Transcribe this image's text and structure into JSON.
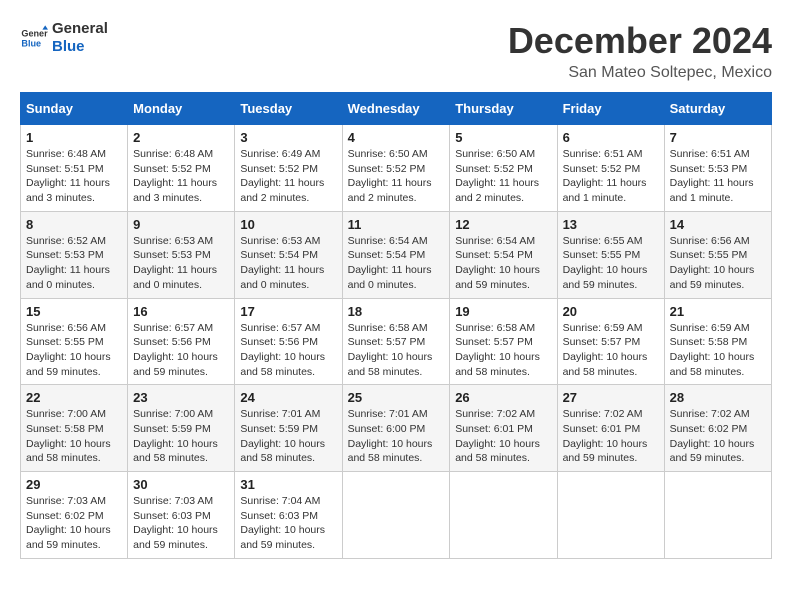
{
  "header": {
    "logo_line1": "General",
    "logo_line2": "Blue",
    "title": "December 2024",
    "subtitle": "San Mateo Soltepec, Mexico"
  },
  "weekdays": [
    "Sunday",
    "Monday",
    "Tuesday",
    "Wednesday",
    "Thursday",
    "Friday",
    "Saturday"
  ],
  "weeks": [
    [
      {
        "day": "1",
        "sunrise": "6:48 AM",
        "sunset": "5:51 PM",
        "daylight": "11 hours and 3 minutes."
      },
      {
        "day": "2",
        "sunrise": "6:48 AM",
        "sunset": "5:52 PM",
        "daylight": "11 hours and 3 minutes."
      },
      {
        "day": "3",
        "sunrise": "6:49 AM",
        "sunset": "5:52 PM",
        "daylight": "11 hours and 2 minutes."
      },
      {
        "day": "4",
        "sunrise": "6:50 AM",
        "sunset": "5:52 PM",
        "daylight": "11 hours and 2 minutes."
      },
      {
        "day": "5",
        "sunrise": "6:50 AM",
        "sunset": "5:52 PM",
        "daylight": "11 hours and 2 minutes."
      },
      {
        "day": "6",
        "sunrise": "6:51 AM",
        "sunset": "5:52 PM",
        "daylight": "11 hours and 1 minute."
      },
      {
        "day": "7",
        "sunrise": "6:51 AM",
        "sunset": "5:53 PM",
        "daylight": "11 hours and 1 minute."
      }
    ],
    [
      {
        "day": "8",
        "sunrise": "6:52 AM",
        "sunset": "5:53 PM",
        "daylight": "11 hours and 0 minutes."
      },
      {
        "day": "9",
        "sunrise": "6:53 AM",
        "sunset": "5:53 PM",
        "daylight": "11 hours and 0 minutes."
      },
      {
        "day": "10",
        "sunrise": "6:53 AM",
        "sunset": "5:54 PM",
        "daylight": "11 hours and 0 minutes."
      },
      {
        "day": "11",
        "sunrise": "6:54 AM",
        "sunset": "5:54 PM",
        "daylight": "11 hours and 0 minutes."
      },
      {
        "day": "12",
        "sunrise": "6:54 AM",
        "sunset": "5:54 PM",
        "daylight": "10 hours and 59 minutes."
      },
      {
        "day": "13",
        "sunrise": "6:55 AM",
        "sunset": "5:55 PM",
        "daylight": "10 hours and 59 minutes."
      },
      {
        "day": "14",
        "sunrise": "6:56 AM",
        "sunset": "5:55 PM",
        "daylight": "10 hours and 59 minutes."
      }
    ],
    [
      {
        "day": "15",
        "sunrise": "6:56 AM",
        "sunset": "5:55 PM",
        "daylight": "10 hours and 59 minutes."
      },
      {
        "day": "16",
        "sunrise": "6:57 AM",
        "sunset": "5:56 PM",
        "daylight": "10 hours and 59 minutes."
      },
      {
        "day": "17",
        "sunrise": "6:57 AM",
        "sunset": "5:56 PM",
        "daylight": "10 hours and 58 minutes."
      },
      {
        "day": "18",
        "sunrise": "6:58 AM",
        "sunset": "5:57 PM",
        "daylight": "10 hours and 58 minutes."
      },
      {
        "day": "19",
        "sunrise": "6:58 AM",
        "sunset": "5:57 PM",
        "daylight": "10 hours and 58 minutes."
      },
      {
        "day": "20",
        "sunrise": "6:59 AM",
        "sunset": "5:57 PM",
        "daylight": "10 hours and 58 minutes."
      },
      {
        "day": "21",
        "sunrise": "6:59 AM",
        "sunset": "5:58 PM",
        "daylight": "10 hours and 58 minutes."
      }
    ],
    [
      {
        "day": "22",
        "sunrise": "7:00 AM",
        "sunset": "5:58 PM",
        "daylight": "10 hours and 58 minutes."
      },
      {
        "day": "23",
        "sunrise": "7:00 AM",
        "sunset": "5:59 PM",
        "daylight": "10 hours and 58 minutes."
      },
      {
        "day": "24",
        "sunrise": "7:01 AM",
        "sunset": "5:59 PM",
        "daylight": "10 hours and 58 minutes."
      },
      {
        "day": "25",
        "sunrise": "7:01 AM",
        "sunset": "6:00 PM",
        "daylight": "10 hours and 58 minutes."
      },
      {
        "day": "26",
        "sunrise": "7:02 AM",
        "sunset": "6:01 PM",
        "daylight": "10 hours and 58 minutes."
      },
      {
        "day": "27",
        "sunrise": "7:02 AM",
        "sunset": "6:01 PM",
        "daylight": "10 hours and 59 minutes."
      },
      {
        "day": "28",
        "sunrise": "7:02 AM",
        "sunset": "6:02 PM",
        "daylight": "10 hours and 59 minutes."
      }
    ],
    [
      {
        "day": "29",
        "sunrise": "7:03 AM",
        "sunset": "6:02 PM",
        "daylight": "10 hours and 59 minutes."
      },
      {
        "day": "30",
        "sunrise": "7:03 AM",
        "sunset": "6:03 PM",
        "daylight": "10 hours and 59 minutes."
      },
      {
        "day": "31",
        "sunrise": "7:04 AM",
        "sunset": "6:03 PM",
        "daylight": "10 hours and 59 minutes."
      },
      null,
      null,
      null,
      null
    ]
  ]
}
